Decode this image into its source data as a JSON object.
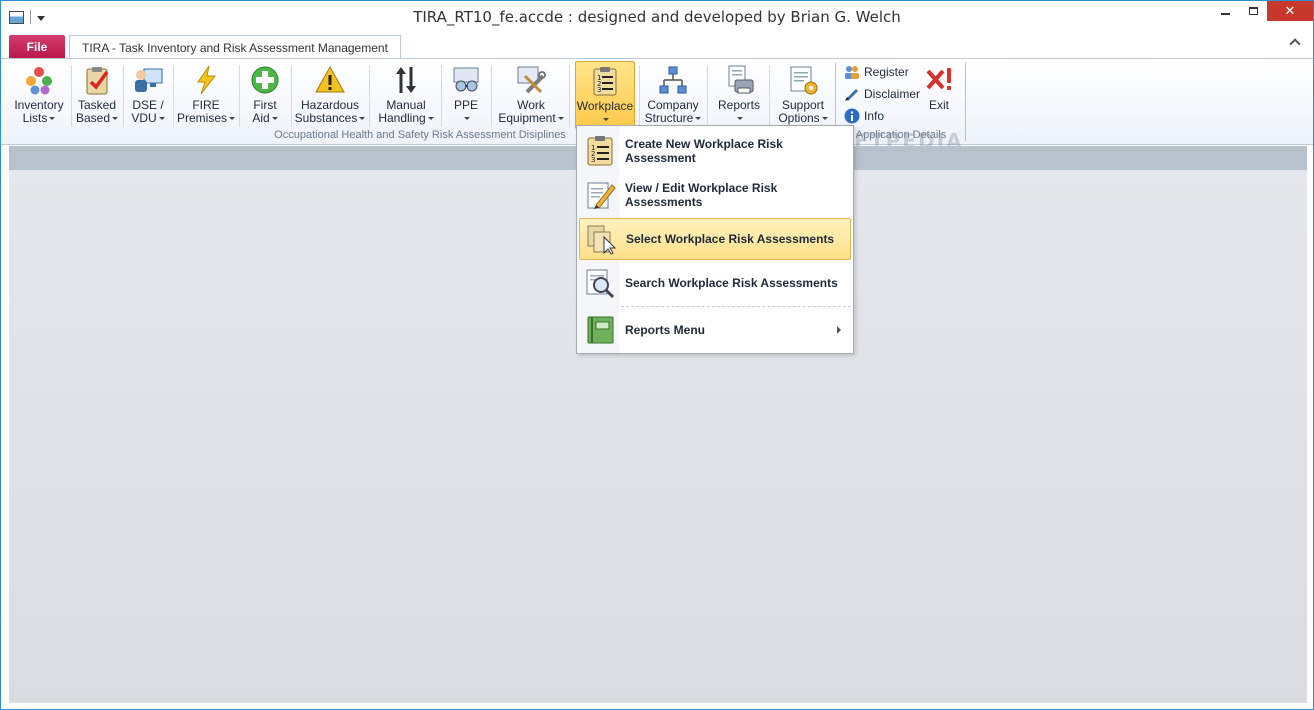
{
  "window": {
    "title": "TIRA_RT10_fe.accde : designed and developed by Brian G. Welch"
  },
  "tabs": {
    "file_label": "File",
    "main_label": "TIRA - Task Inventory and Risk Assessment Management"
  },
  "ribbon": {
    "buttons": [
      {
        "line1": "Inventory",
        "line2": "Lists"
      },
      {
        "line1": "Tasked",
        "line2": "Based"
      },
      {
        "line1": "DSE /",
        "line2": "VDU"
      },
      {
        "line1": "FIRE",
        "line2": "Premises"
      },
      {
        "line1": "First",
        "line2": "Aid"
      },
      {
        "line1": "Hazardous",
        "line2": "Substances"
      },
      {
        "line1": "Manual",
        "line2": "Handling"
      },
      {
        "line1": "PPE",
        "line2": ""
      },
      {
        "line1": "Work",
        "line2": "Equipment"
      },
      {
        "line1": "Workplace",
        "line2": ""
      },
      {
        "line1": "Company",
        "line2": "Structure"
      },
      {
        "line1": "Reports",
        "line2": ""
      },
      {
        "line1": "Support",
        "line2": "Options"
      }
    ],
    "group1_label": "Occupational Health and Safety Risk Assessment Disiplines",
    "group2_label": "Application Details",
    "register_label": "Register",
    "disclaimer_label": "Disclaimer",
    "info_label": "Info",
    "exit_label": "Exit"
  },
  "watermark": "SOFTPEDIA",
  "menu": {
    "items": [
      {
        "label": "Create New Workplace Risk Assessment",
        "icon": "checklist-icon"
      },
      {
        "label": "View / Edit Workplace Risk Assessments",
        "icon": "edit-pencil-icon"
      },
      {
        "label": "Select Workplace Risk Assessments",
        "icon": "select-cursor-icon"
      },
      {
        "label": "Search Workplace Risk Assessments",
        "icon": "magnifier-icon"
      },
      {
        "label": "Reports Menu",
        "icon": "green-book-icon"
      }
    ]
  },
  "colors": {
    "file_tab": "#c41f52",
    "highlight": "#ffd75e",
    "window_border": "#2f8fd3"
  }
}
